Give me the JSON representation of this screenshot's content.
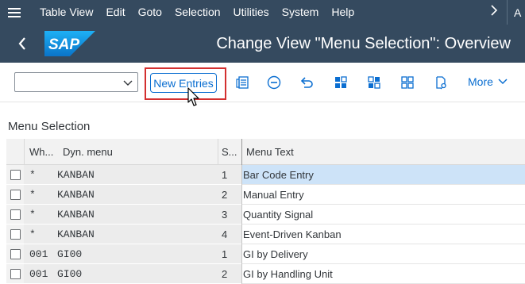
{
  "menubar": {
    "items": [
      "Table View",
      "Edit",
      "Goto",
      "Selection",
      "Utilities",
      "System",
      "Help"
    ],
    "truncated_item": "A"
  },
  "shell": {
    "logo_text": "SAP",
    "title": "Change View \"Menu Selection\": Overview"
  },
  "toolbar": {
    "combo_value": "",
    "new_entries_label": "New Entries",
    "more_label": "More"
  },
  "table": {
    "section_title": "Menu Selection",
    "columns": [
      "Wh...",
      "Dyn. menu",
      "S...",
      "Menu Text"
    ],
    "rows": [
      {
        "wh": "*",
        "menu": "KANBAN",
        "seq": "1",
        "text": "Bar Code Entry",
        "selected": true
      },
      {
        "wh": "*",
        "menu": "KANBAN",
        "seq": "2",
        "text": "Manual Entry",
        "selected": false
      },
      {
        "wh": "*",
        "menu": "KANBAN",
        "seq": "3",
        "text": "Quantity Signal",
        "selected": false
      },
      {
        "wh": "*",
        "menu": "KANBAN",
        "seq": "4",
        "text": "Event-Driven Kanban",
        "selected": false
      },
      {
        "wh": "001",
        "menu": "GI00",
        "seq": "1",
        "text": "GI by Delivery",
        "selected": false
      },
      {
        "wh": "001",
        "menu": "GI00",
        "seq": "2",
        "text": "GI by Handling Unit",
        "selected": false
      }
    ]
  },
  "colors": {
    "shell_bg": "#354a5f",
    "accent": "#0a6ed1",
    "highlight_border": "#d32f2f",
    "selected_row": "#cde3f8"
  },
  "icons": [
    "menu-icon",
    "chevron-right-icon",
    "back-icon",
    "sap-logo",
    "dropdown-icon",
    "details-icon",
    "delete-icon",
    "undo-icon",
    "select-all-icon",
    "select-block-icon",
    "deselect-icon",
    "print-icon",
    "mouse-cursor"
  ]
}
